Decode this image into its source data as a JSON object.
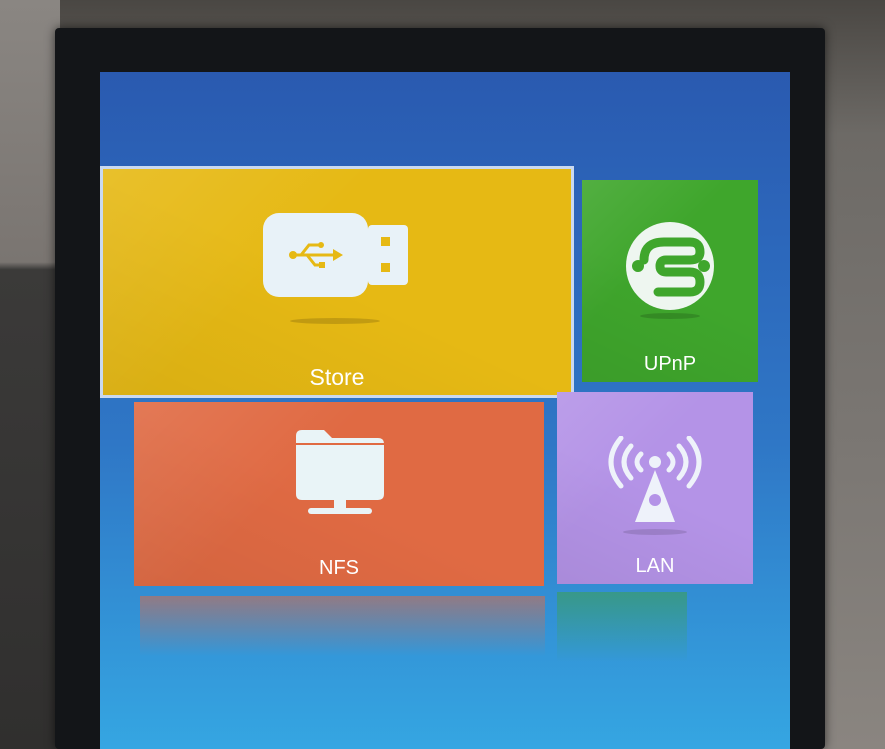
{
  "tiles": {
    "store": {
      "label": "Store",
      "icon": "usb-drive-icon",
      "color": "#e6b914"
    },
    "upnp": {
      "label": "UPnP",
      "icon": "upnp-icon",
      "color": "#3fa62c"
    },
    "nfs": {
      "label": "NFS",
      "icon": "folder-monitor-icon",
      "color": "#e06a43"
    },
    "lan": {
      "label": "LAN",
      "icon": "antenna-icon",
      "color": "#b493e7"
    }
  },
  "colors": {
    "screen_top": "#2a5ab0",
    "screen_bottom": "#35a6e2",
    "bezel": "#131518"
  }
}
